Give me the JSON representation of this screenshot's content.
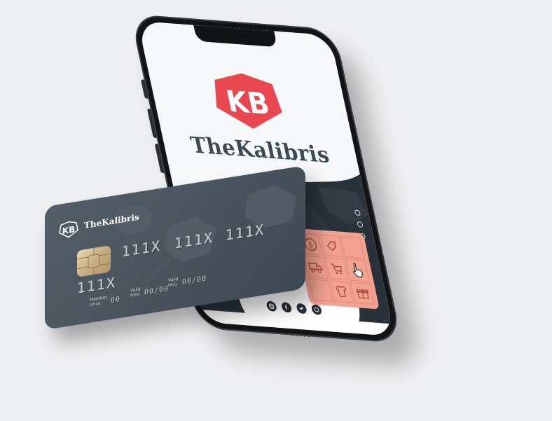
{
  "brand": {
    "name": "TheKalibris",
    "logo_letters": "KB",
    "accent_color": "#e8474f",
    "dark_color": "#3d4a55"
  },
  "phone": {
    "tile_icons": [
      "dollar-icon",
      "tag-icon",
      "blank",
      "truck-icon",
      "cart-icon",
      "hand-pointer-icon",
      "blank",
      "shirt-icon",
      "gift-icon"
    ],
    "social_icons": [
      "instagram-icon",
      "facebook-icon",
      "twitter-icon",
      "whatsapp-icon"
    ],
    "tile_color": "#f2a291"
  },
  "card": {
    "brand_name": "TheKalibris",
    "numbers": [
      "111X",
      "111X",
      "111X",
      "111X"
    ],
    "member_since_label": "Member since",
    "member_since_value": "00",
    "valid_from_label": "Valid from",
    "valid_from_value": "00/00",
    "valid_thru_label": "Valid thru",
    "valid_thru_value": "00/00",
    "card_color": "#4a555f"
  }
}
